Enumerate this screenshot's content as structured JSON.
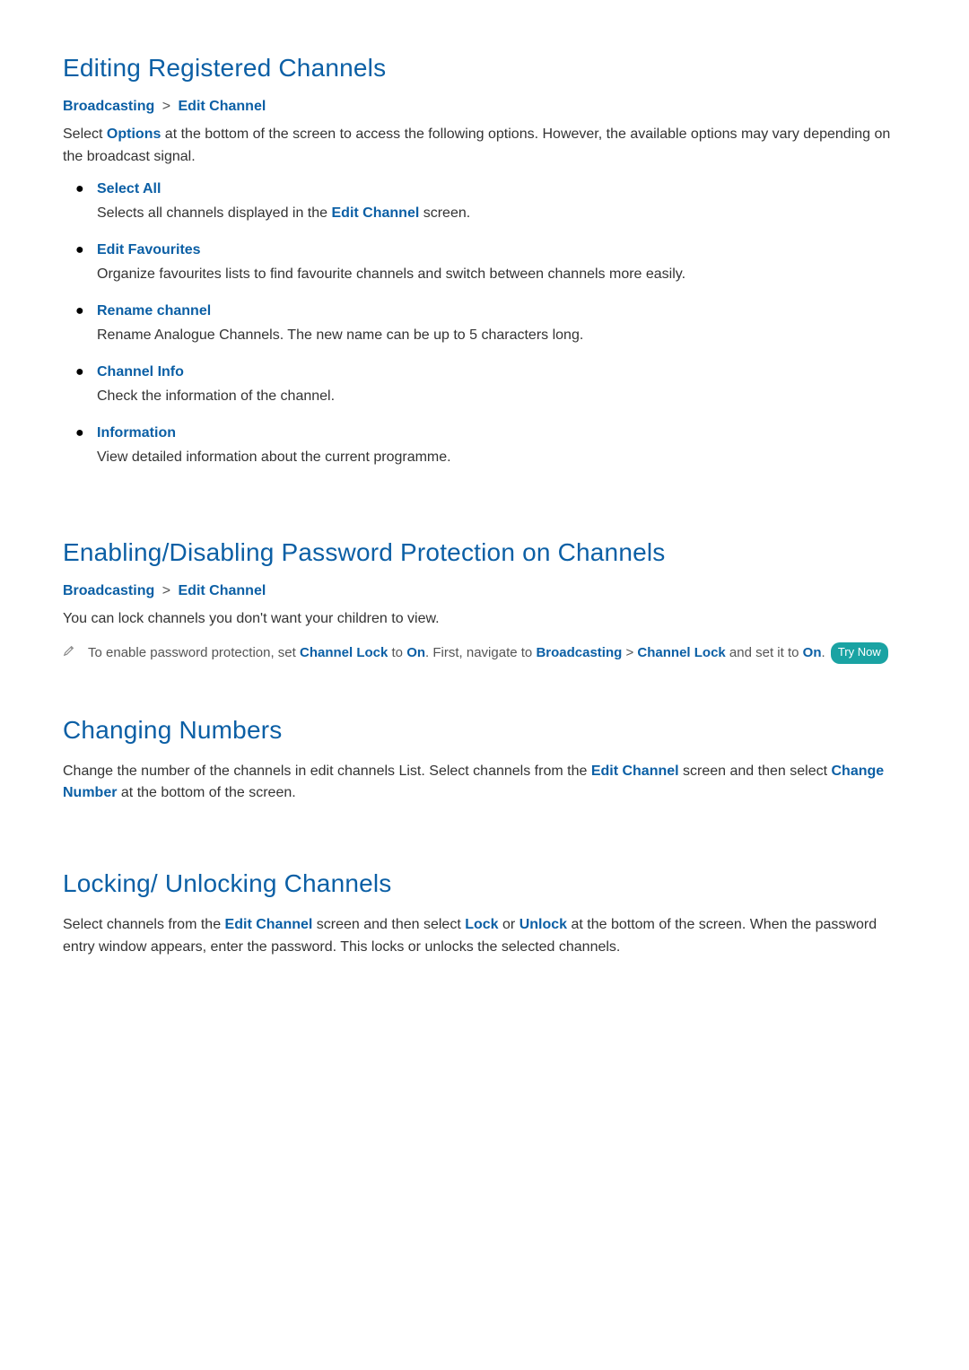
{
  "section1": {
    "title": "Editing Registered Channels",
    "breadcrumb": {
      "a": "Broadcasting",
      "sep": ">",
      "b": "Edit Channel"
    },
    "intro_pre": "Select ",
    "intro_kw": "Options",
    "intro_post": " at the bottom of the screen to access the following options. However, the available options may vary depending on the broadcast signal.",
    "options": [
      {
        "name": "Select All",
        "desc_pre": "Selects all channels displayed in the ",
        "desc_kw": "Edit Channel",
        "desc_post": " screen."
      },
      {
        "name": "Edit Favourites",
        "desc": "Organize favourites lists to find favourite channels and switch between channels more easily."
      },
      {
        "name": "Rename channel",
        "desc": "Rename Analogue Channels. The new name can be up to 5 characters long."
      },
      {
        "name": "Channel Info",
        "desc": "Check the information of the channel."
      },
      {
        "name": "Information",
        "desc": "View detailed information about the current programme."
      }
    ]
  },
  "section2": {
    "title": "Enabling/Disabling Password Protection on Channels",
    "breadcrumb": {
      "a": "Broadcasting",
      "sep": ">",
      "b": "Edit Channel"
    },
    "line": "You can lock channels you don't want your children to view.",
    "note": {
      "t1": "To enable password protection, set ",
      "kw1": "Channel Lock",
      "t2": " to ",
      "kw2": "On",
      "t3": ". First, navigate to ",
      "kw3": "Broadcasting",
      "sep": " > ",
      "kw4": "Channel Lock",
      "t4": " and set it to ",
      "kw5": "On",
      "t5": ". ",
      "try_now": "Try Now"
    }
  },
  "section3": {
    "title": "Changing Numbers",
    "p_t1": "Change the number of the channels in edit channels List. Select channels from the ",
    "p_kw1": "Edit Channel",
    "p_t2": " screen and then select ",
    "p_kw2": "Change Number",
    "p_t3": " at the bottom of the screen."
  },
  "section4": {
    "title": "Locking/ Unlocking Channels",
    "p_t1": "Select channels from the ",
    "p_kw1": "Edit Channel",
    "p_t2": " screen and then select ",
    "p_kw2": "Lock",
    "p_t3": " or ",
    "p_kw3": "Unlock",
    "p_t4": " at the bottom of the screen. When the password entry window appears, enter the password. This locks or unlocks the selected channels."
  }
}
